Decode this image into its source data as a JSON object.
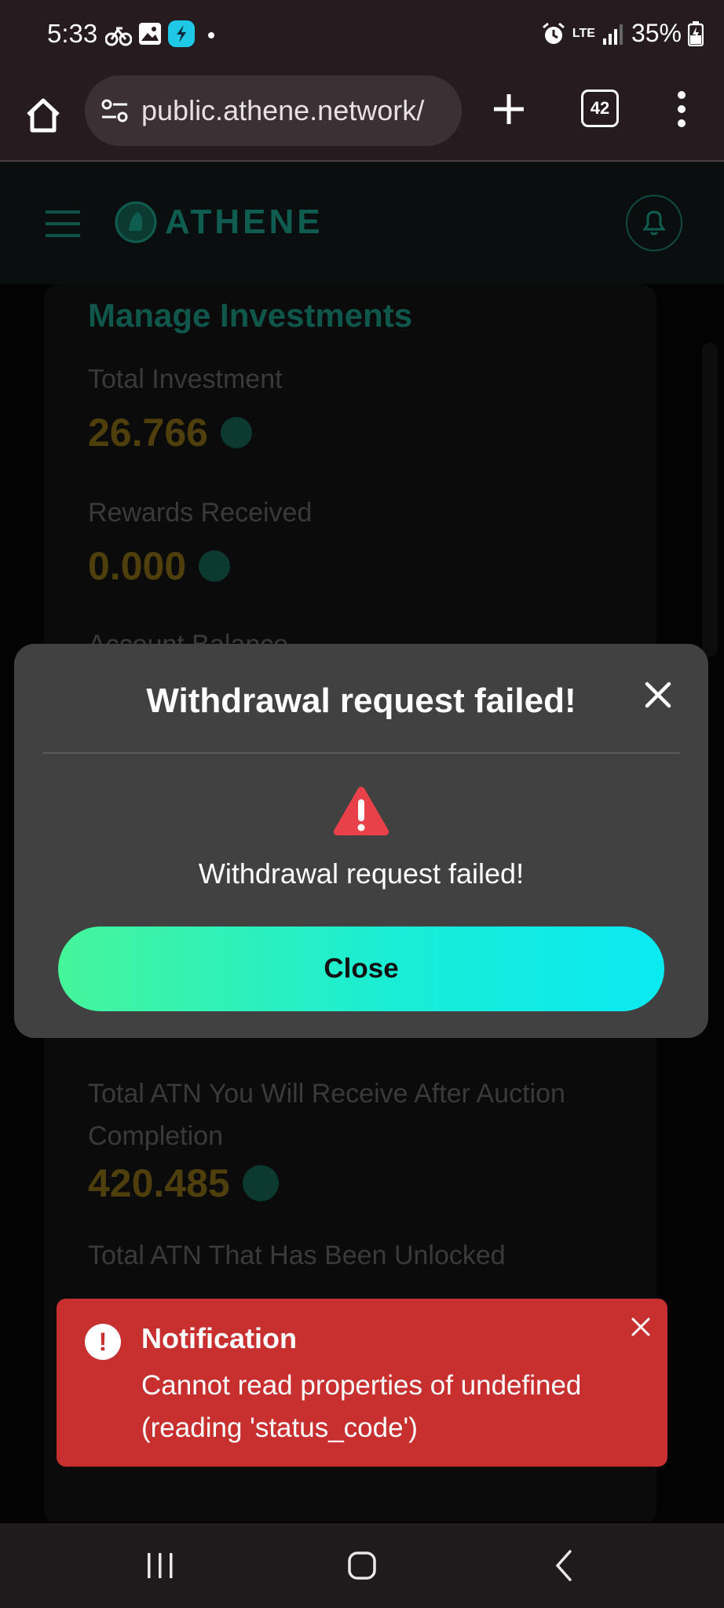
{
  "status_bar": {
    "time": "5:33",
    "battery": "35%",
    "network": "LTE"
  },
  "browser": {
    "url": "public.athene.network/",
    "tab_count": "42"
  },
  "site": {
    "logo_text": "ATHENE"
  },
  "card": {
    "title": "Manage Investments",
    "total_investment_label": "Total Investment",
    "total_investment_value": "26.766",
    "rewards_label": "Rewards Received",
    "rewards_value": "0.000",
    "account_balance_label": "Account Balance",
    "atn_receive_label": "Total ATN You Will Receive After Auction Completion",
    "atn_receive_value": "420.485",
    "atn_unlocked_label": "Total ATN That Has Been Unlocked"
  },
  "modal": {
    "title": "Withdrawal request failed!",
    "message": "Withdrawal request failed!",
    "close_label": "Close"
  },
  "toast": {
    "title": "Notification",
    "message": "Cannot read properties of undefined (reading 'status_code')"
  },
  "colors": {
    "modal_bg": "#414141",
    "toast_bg": "#c83030",
    "button_gradient_start": "#45f59a",
    "button_gradient_end": "#0aeaf2",
    "warning": "#e9414a"
  }
}
